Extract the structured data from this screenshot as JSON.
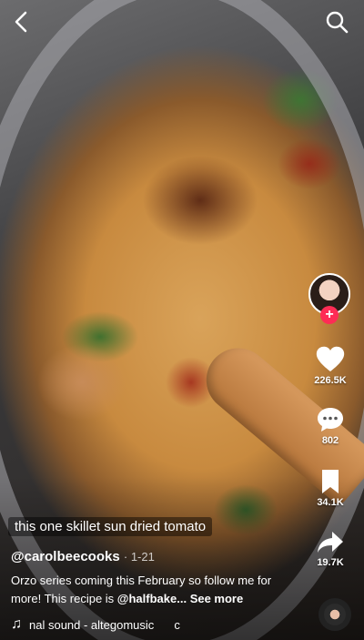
{
  "overlay_caption": "this one skillet sun dried tomato",
  "post": {
    "author": "@carolbeecooks",
    "timestamp": "1-21",
    "description": "Orzo series coming this February so follow me for more! This recipe is ",
    "mention": "@halfbake...",
    "see_more": "See more"
  },
  "music": {
    "label": "nal sound - altegomusic",
    "trailing": "c"
  },
  "actions": {
    "likes": "226.5K",
    "comments": "802",
    "saves": "34.1K",
    "shares": "19.7K"
  },
  "icons": {
    "back": "chevron-left-icon",
    "search": "search-icon",
    "like": "heart-icon",
    "comment": "comment-icon",
    "save": "bookmark-icon",
    "share": "share-icon",
    "follow": "plus-icon",
    "music": "music-note-icon"
  },
  "colors": {
    "accent": "#fe2c55"
  },
  "follow_label": "+"
}
